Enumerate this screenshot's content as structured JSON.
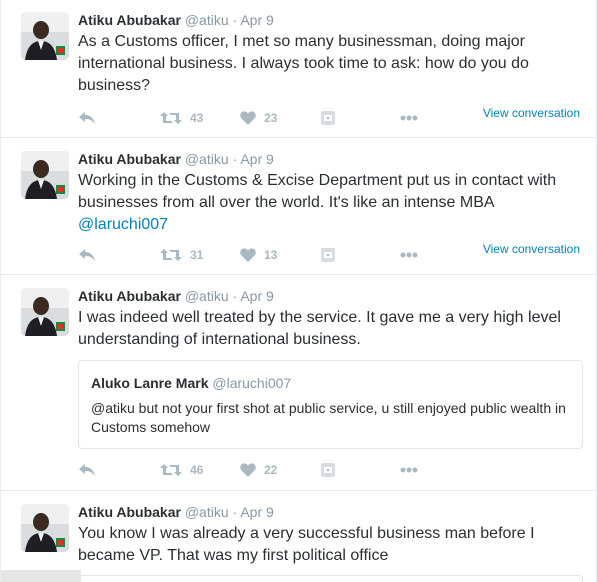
{
  "tweets": [
    {
      "name": "Atiku Abubakar",
      "handle": "@atiku",
      "sep": "·",
      "time": "Apr 9",
      "text": "As a Customs officer, I met so many businessman, doing major international business. I always took time to ask: how do you do business?",
      "retweets": "43",
      "likes": "23",
      "view_conversation": "View conversation"
    },
    {
      "name": "Atiku Abubakar",
      "handle": "@atiku",
      "sep": "·",
      "time": "Apr 9",
      "text": "Working in the Customs & Excise Department put us in contact with businesses from all over the world. It's like an intense MBA",
      "mention": "@laruchi007",
      "retweets": "31",
      "likes": "13",
      "view_conversation": "View conversation"
    },
    {
      "name": "Atiku Abubakar",
      "handle": "@atiku",
      "sep": "·",
      "time": "Apr 9",
      "text": "I was indeed well treated by the service. It gave me a very high level understanding of international business.",
      "quote": {
        "name": "Aluko Lanre Mark",
        "handle": "@laruchi007",
        "text": "@atiku  but not your first shot at public service, u still enjoyed public wealth in Customs somehow"
      },
      "retweets": "46",
      "likes": "22"
    },
    {
      "name": "Atiku Abubakar",
      "handle": "@atiku",
      "sep": "·",
      "time": "Apr 9",
      "text": "You know I was already a very successful business man before I became VP. That was my first political office"
    }
  ],
  "icons": {
    "reply": "reply-icon",
    "retweet": "retweet-icon",
    "like": "heart-icon",
    "media": "media-icon",
    "more": "more-dots-icon"
  },
  "colors": {
    "link": "#0084b4",
    "icon": "#aab8c2",
    "meta": "#8899a6",
    "text": "#292f33",
    "border": "#e6ecf0"
  }
}
